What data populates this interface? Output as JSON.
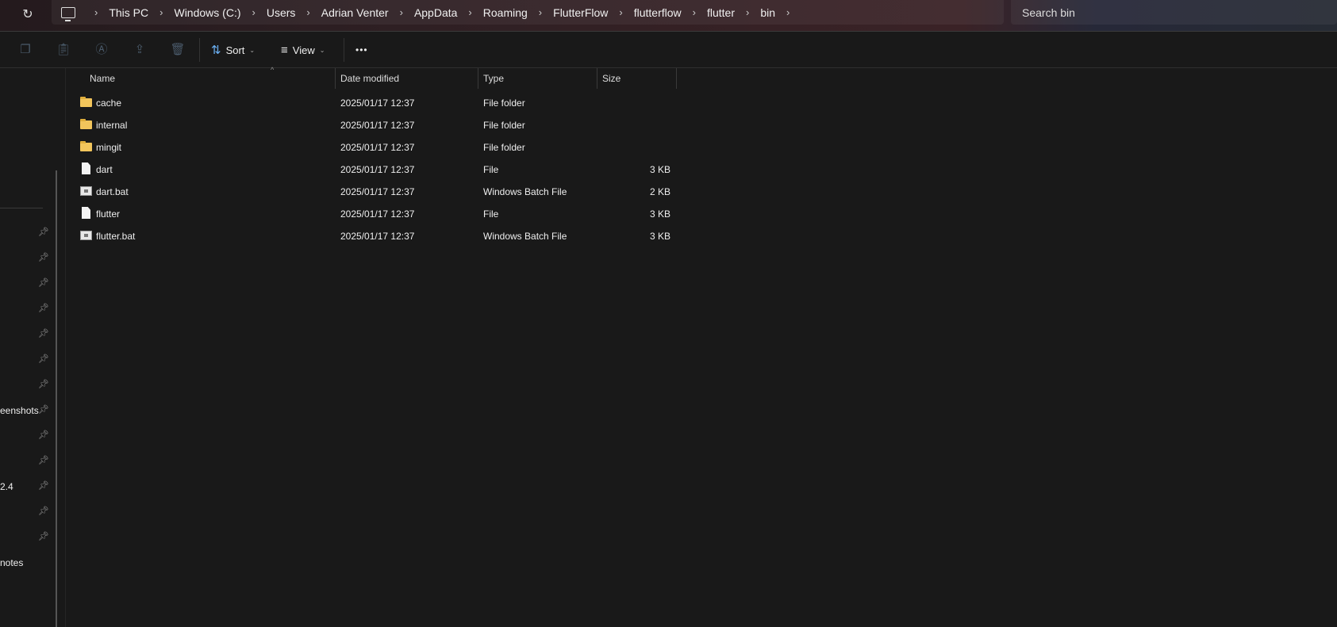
{
  "address_bar": {
    "breadcrumbs": [
      "This PC",
      "Windows (C:)",
      "Users",
      "Adrian Venter",
      "AppData",
      "Roaming",
      "FlutterFlow",
      "flutterflow",
      "flutter",
      "bin"
    ],
    "search_placeholder": "Search bin"
  },
  "toolbar": {
    "sort_label": "Sort",
    "view_label": "View",
    "more_label": "•••"
  },
  "sidebar": {
    "partial_labels": [
      "eenshots",
      "2.4",
      "notes"
    ]
  },
  "columns": {
    "name": "Name",
    "date": "Date modified",
    "type": "Type",
    "size": "Size"
  },
  "files": [
    {
      "name": "cache",
      "date": "2025/01/17 12:37",
      "type": "File folder",
      "size": "",
      "icon": "folder"
    },
    {
      "name": "internal",
      "date": "2025/01/17 12:37",
      "type": "File folder",
      "size": "",
      "icon": "folder"
    },
    {
      "name": "mingit",
      "date": "2025/01/17 12:37",
      "type": "File folder",
      "size": "",
      "icon": "folder"
    },
    {
      "name": "dart",
      "date": "2025/01/17 12:37",
      "type": "File",
      "size": "3 KB",
      "icon": "file"
    },
    {
      "name": "dart.bat",
      "date": "2025/01/17 12:37",
      "type": "Windows Batch File",
      "size": "2 KB",
      "icon": "bat"
    },
    {
      "name": "flutter",
      "date": "2025/01/17 12:37",
      "type": "File",
      "size": "3 KB",
      "icon": "file"
    },
    {
      "name": "flutter.bat",
      "date": "2025/01/17 12:37",
      "type": "Windows Batch File",
      "size": "3 KB",
      "icon": "bat"
    }
  ]
}
